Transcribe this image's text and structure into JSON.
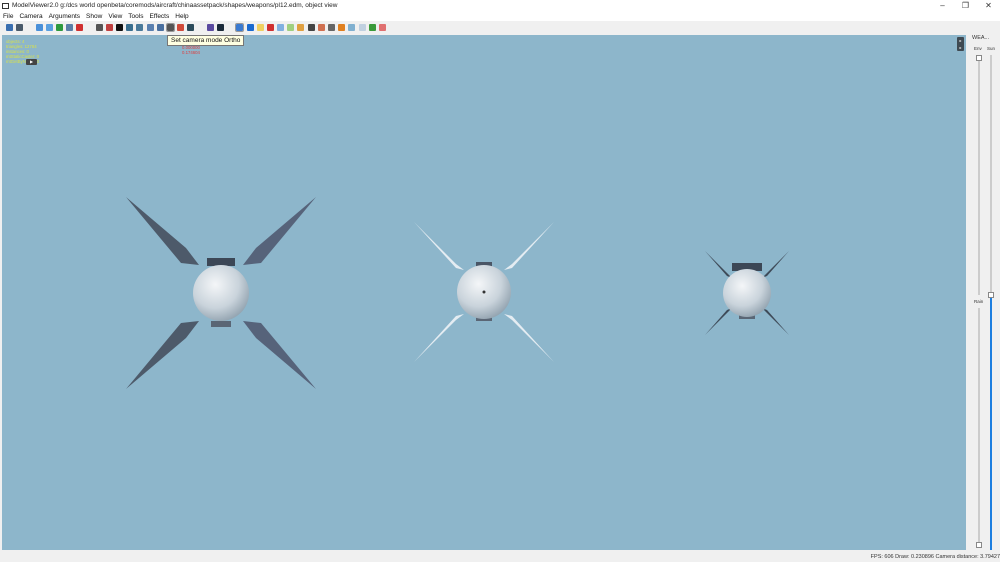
{
  "window": {
    "title": "ModelViewer2.0 g:/dcs world openbeta/coremods/aircraft/chinaassetpack/shapes/weapons/pl12.edm, object view",
    "minimize": "–",
    "restore": "❐",
    "close": "✕"
  },
  "menu": [
    "File",
    "Camera",
    "Arguments",
    "Show",
    "View",
    "Tools",
    "Effects",
    "Help"
  ],
  "toolbar": {
    "icons": [
      {
        "name": "save-icon",
        "color": "#3a6fb0"
      },
      {
        "name": "reload-icon",
        "color": "#4a5a6a"
      },
      {
        "name": "sep"
      },
      {
        "name": "globe-icon",
        "color": "#4a90d9"
      },
      {
        "name": "ring-icon",
        "color": "#5aa0e0"
      },
      {
        "name": "refresh-icon",
        "color": "#2e9a3e"
      },
      {
        "name": "grid-window-icon",
        "color": "#5a7fa8"
      },
      {
        "name": "person-red-icon",
        "color": "#d03030"
      },
      {
        "name": "sep"
      },
      {
        "name": "skeleton-icon",
        "color": "#555"
      },
      {
        "name": "dot-icon",
        "color": "#c04040"
      },
      {
        "name": "black-square-icon",
        "color": "#111"
      },
      {
        "name": "lamp-icon",
        "color": "#3a6f8f"
      },
      {
        "name": "figure-icon",
        "color": "#4a7a9a"
      },
      {
        "name": "arrow-left-icon",
        "color": "#5a80b0"
      },
      {
        "name": "arrow-right-icon",
        "color": "#4a70a0"
      },
      {
        "name": "ortho-camera-icon",
        "color": "#555",
        "active": true
      },
      {
        "name": "color-balls-icon",
        "color": "#d04a3a"
      },
      {
        "name": "dark-screen-icon",
        "color": "#2a4a5a"
      },
      {
        "name": "sep"
      },
      {
        "name": "undo-icon",
        "color": "#5a4aa0"
      },
      {
        "name": "sphere-dark-icon",
        "color": "#1a2a3a"
      },
      {
        "name": "sep"
      },
      {
        "name": "bar-chart-icon",
        "color": "#3a7ad0",
        "active": true
      },
      {
        "name": "blue-dot-icon",
        "color": "#1a6ad0"
      },
      {
        "name": "folder-icon",
        "color": "#f0d060"
      },
      {
        "name": "red-ball-icon",
        "color": "#d03030"
      },
      {
        "name": "light-blue-icon",
        "color": "#80b0e0"
      },
      {
        "name": "green-light-icon",
        "color": "#a0d080"
      },
      {
        "name": "graph-icon",
        "color": "#e0a040"
      },
      {
        "name": "pin-icon",
        "color": "#444"
      },
      {
        "name": "person-icon",
        "color": "#d07050"
      },
      {
        "name": "ship-icon",
        "color": "#666"
      },
      {
        "name": "orange-ball-icon",
        "color": "#e08020"
      },
      {
        "name": "tree-icon",
        "color": "#80b0d0"
      },
      {
        "name": "panel-icon",
        "color": "#c0d0e0"
      },
      {
        "name": "green-grid-icon",
        "color": "#3a9a3a"
      },
      {
        "name": "stop-icon",
        "color": "#e07070"
      }
    ]
  },
  "tooltip": "Set camera mode Ortho",
  "stats": [
    "objects: 4",
    "triangles: 12784",
    "instances: 0",
    "mtStaticCaster: 0",
    "mtGetByName: 0"
  ],
  "red_values": [
    "0.000000",
    "0.174604"
  ],
  "viewport_controls": [
    "▸",
    "▸"
  ],
  "weather_panel": {
    "title": "WEA...",
    "env_label": "Env",
    "sun_label": "Sun",
    "rain_label": "Rain",
    "env_level": 1.0,
    "sun_level": 0.0,
    "rain_level": 0.0,
    "sun_fill_color": "#1e7fe0"
  },
  "status": "FPS: 606  Draw: 0.230896  Camera distance: 3.79427",
  "colors": {
    "viewport_bg": "#8db6cb",
    "stats_text": "#d9e24a",
    "red_text": "#e03b3b"
  }
}
